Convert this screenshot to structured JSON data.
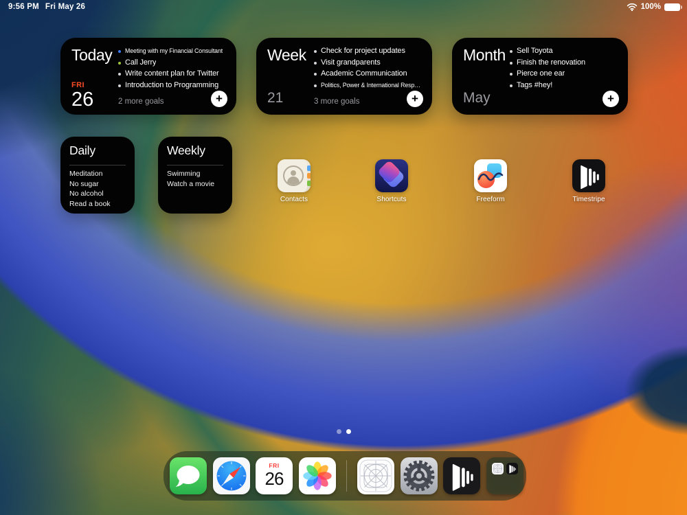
{
  "status_bar": {
    "time": "9:56 PM",
    "date": "Fri May 26",
    "battery_percent": "100%"
  },
  "ui": {
    "plus": "+"
  },
  "colors": {
    "widget_bg": "#030303",
    "accent_red_date": "#fd4b26",
    "muted_gray": "#9a9aa0",
    "bullet_default": "#d4d4d8",
    "bullet_blue": "#3d7bf5",
    "bullet_green": "#9dc33b",
    "page_dot_active": "#ffffff"
  },
  "widgets": {
    "today": {
      "title": "Today",
      "goals": [
        {
          "text": "Meeting with my Financial Consultant",
          "dot": "#3d7bf5",
          "size": "small"
        },
        {
          "text": "Call Jerry",
          "dot": "#9dc33b"
        },
        {
          "text": "Write content plan for Twitter",
          "dot": "#d4d4d8"
        },
        {
          "text": "Introduction to Programming",
          "dot": "#d4d4d8"
        }
      ],
      "weekday": "FRI",
      "day": "26",
      "more_goals": "2 more goals"
    },
    "week": {
      "title": "Week",
      "goals": [
        {
          "text": "Check for project updates",
          "dot": "#d4d4d8"
        },
        {
          "text": "Visit grandparents",
          "dot": "#d4d4d8"
        },
        {
          "text": "Academic Communication",
          "dot": "#d4d4d8"
        },
        {
          "text": "Politics, Power & International Resp…",
          "dot": "#d4d4d8",
          "size": "small"
        }
      ],
      "period": "21",
      "more_goals": "3 more goals"
    },
    "month": {
      "title": "Month",
      "goals": [
        {
          "text": "Sell Toyota",
          "dot": "#d4d4d8"
        },
        {
          "text": "Finish the renovation",
          "dot": "#d4d4d8"
        },
        {
          "text": "Pierce one ear",
          "dot": "#d4d4d8"
        },
        {
          "text": "Tags #hey!",
          "dot": "#d4d4d8"
        }
      ],
      "period": "May"
    },
    "daily": {
      "title": "Daily",
      "habits": [
        "Meditation",
        "No sugar",
        "No alcohol",
        "Read a book"
      ]
    },
    "weekly": {
      "title": "Weekly",
      "habits": [
        "Swimming",
        "Watch a movie"
      ]
    }
  },
  "apps": [
    {
      "name": "Contacts"
    },
    {
      "name": "Shortcuts"
    },
    {
      "name": "Freeform"
    },
    {
      "name": "Timestripe"
    }
  ],
  "dock": {
    "calendar": {
      "weekday": "FRI",
      "day": "26"
    }
  },
  "page_dots": {
    "total": 2,
    "active_index": 1
  }
}
